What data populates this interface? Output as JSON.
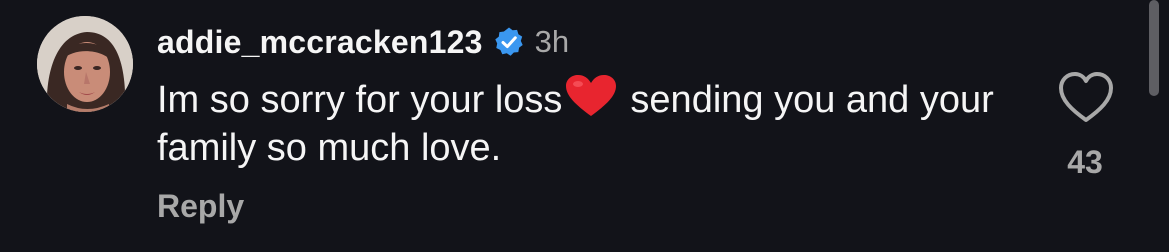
{
  "comment": {
    "username": "addie_mccracken123",
    "timestamp": "3h",
    "text_part1": "Im so sorry for your loss",
    "text_part2": "sending you and your family so much love.",
    "reply_label": "Reply",
    "like_count": "43",
    "verified": true,
    "emoji": "heart-emoji"
  },
  "icons": {
    "verified": "verified-badge-icon",
    "like": "heart-outline-icon"
  },
  "colors": {
    "background": "#121319",
    "text": "#f5f5f5",
    "muted": "#a8a8a8",
    "verified_blue": "#3a97f0",
    "emoji_red": "#e8252f"
  }
}
